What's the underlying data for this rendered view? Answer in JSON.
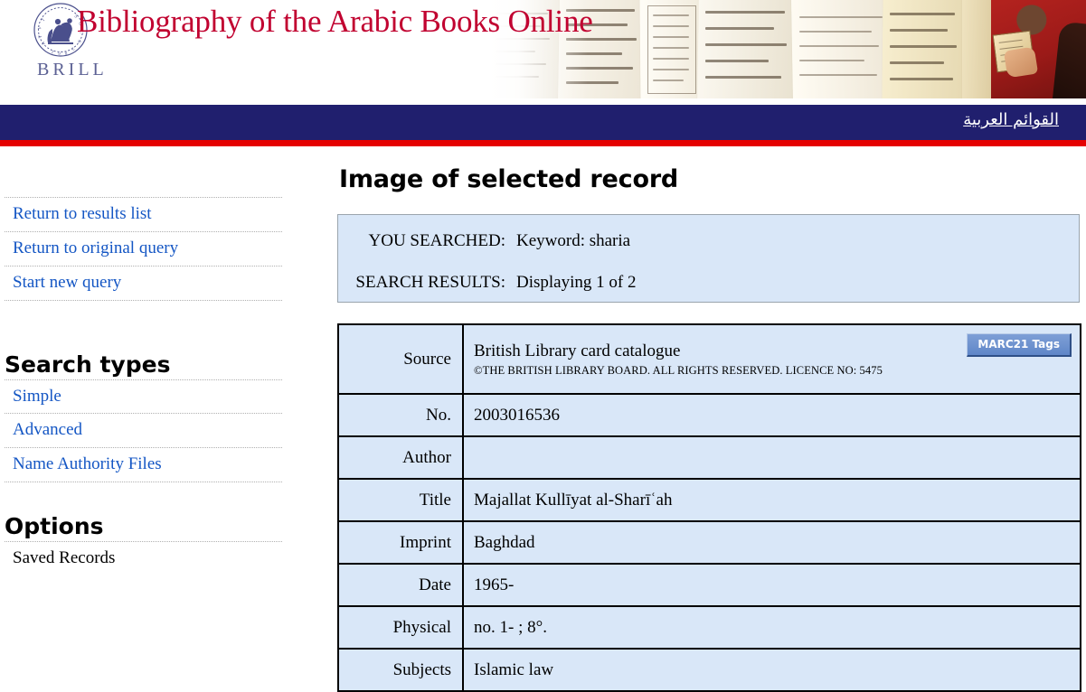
{
  "header": {
    "site_title": "Bibliography of the Arabic Books Online",
    "publisher_wordmark": "BRILL",
    "seal_icon": "brill-seal-icon",
    "banner_icon": "manuscript-banner-image",
    "title_color": "#c10230",
    "wordmark_color": "#5c6194"
  },
  "navbar": {
    "arabic_menu_label": "القوائم العربية",
    "background_color": "#201f6e",
    "accent_color": "#e50000"
  },
  "sidebar": {
    "nav_links": [
      {
        "label": "Return to results list"
      },
      {
        "label": "Return to original query"
      },
      {
        "label": "Start new query"
      }
    ],
    "search_types": {
      "heading": "Search types",
      "items": [
        {
          "label": "Simple"
        },
        {
          "label": "Advanced"
        },
        {
          "label": "Name Authority Files"
        }
      ]
    },
    "options": {
      "heading": "Options",
      "items": [
        {
          "label": "Saved Records"
        }
      ]
    },
    "link_color": "#1456c4"
  },
  "main": {
    "page_title": "Image of selected record",
    "search_info": {
      "rows": [
        {
          "label": "YOU SEARCHED:",
          "value": "Keyword: sharia"
        },
        {
          "label": "SEARCH RESULTS:",
          "value": "Displaying 1 of 2"
        }
      ],
      "background_color": "#d9e7f8"
    },
    "record": {
      "marc_button_label": "MARC21 Tags",
      "source": {
        "label": "Source",
        "value": "British Library card catalogue",
        "copyright": "©THE BRITISH LIBRARY BOARD. ALL RIGHTS RESERVED. LICENCE NO: 5475"
      },
      "fields": [
        {
          "label": "No.",
          "value": "2003016536"
        },
        {
          "label": "Author",
          "value": ""
        },
        {
          "label": "Title",
          "value": "Majallat Kullīyat al-Sharīʿah"
        },
        {
          "label": "Imprint",
          "value": "Baghdad"
        },
        {
          "label": "Date",
          "value": "1965-"
        },
        {
          "label": "Physical",
          "value": "no. 1- ; 8°."
        },
        {
          "label": "Subjects",
          "value": "Islamic law"
        }
      ]
    }
  }
}
